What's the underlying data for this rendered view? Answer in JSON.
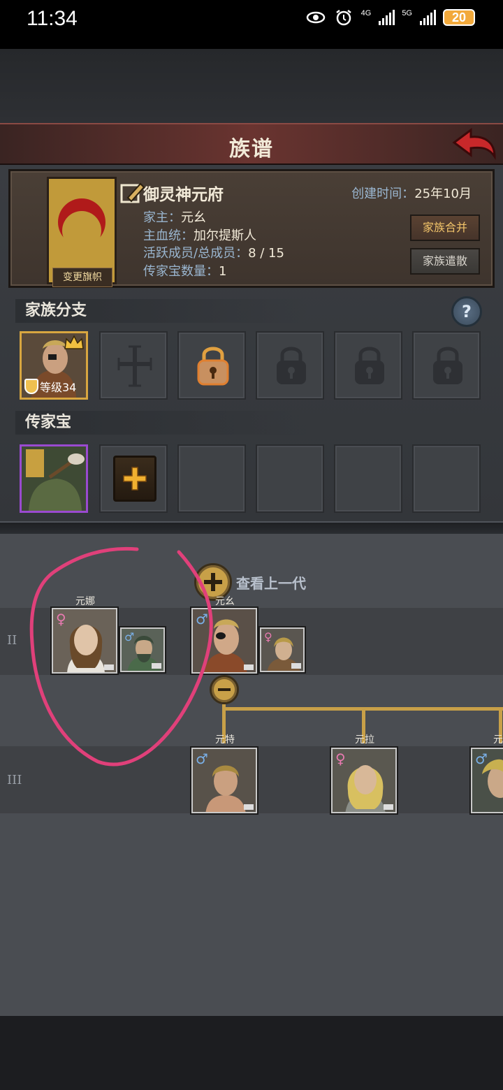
{
  "status_bar": {
    "time": "11:34",
    "network_1": "4G",
    "network_2": "5G",
    "battery": "20"
  },
  "header": {
    "title": "族谱"
  },
  "family": {
    "name": "御灵神元府",
    "create_time_label": "创建时间：",
    "create_time_value": "25年10月",
    "banner_label": "变更旗帜",
    "head_label": "家主：",
    "head_value": "元幺",
    "bloodline_label": "主血统：",
    "bloodline_value": "加尔提斯人",
    "members_label": "活跃成员/总成员：",
    "members_value": "8 / 15",
    "heirloom_label": "传家宝数量：",
    "heirloom_value": "1",
    "merge_button": "家族合并",
    "dissolve_button": "家族遣散"
  },
  "branches": {
    "title": "家族分支",
    "help": "?",
    "hero_level": "等级34"
  },
  "heirlooms": {
    "title": "传家宝"
  },
  "tree": {
    "view_prev": "查看上一代",
    "row_labels": [
      "II",
      "III"
    ],
    "gen2": [
      {
        "name": "元娜",
        "gender": "♀"
      },
      {
        "name": "",
        "gender": "♂"
      },
      {
        "name": "元幺",
        "gender": "♂"
      },
      {
        "name": "",
        "gender": "♀"
      }
    ],
    "gen3": [
      {
        "name": "元特",
        "gender": "♂"
      },
      {
        "name": "元拉",
        "gender": "♀"
      },
      {
        "name": "元",
        "gender": "♂"
      }
    ]
  },
  "colors": {
    "accent_gold": "#c8a048",
    "header_red": "#6a3430",
    "annotation_pink": "#e0407a"
  }
}
